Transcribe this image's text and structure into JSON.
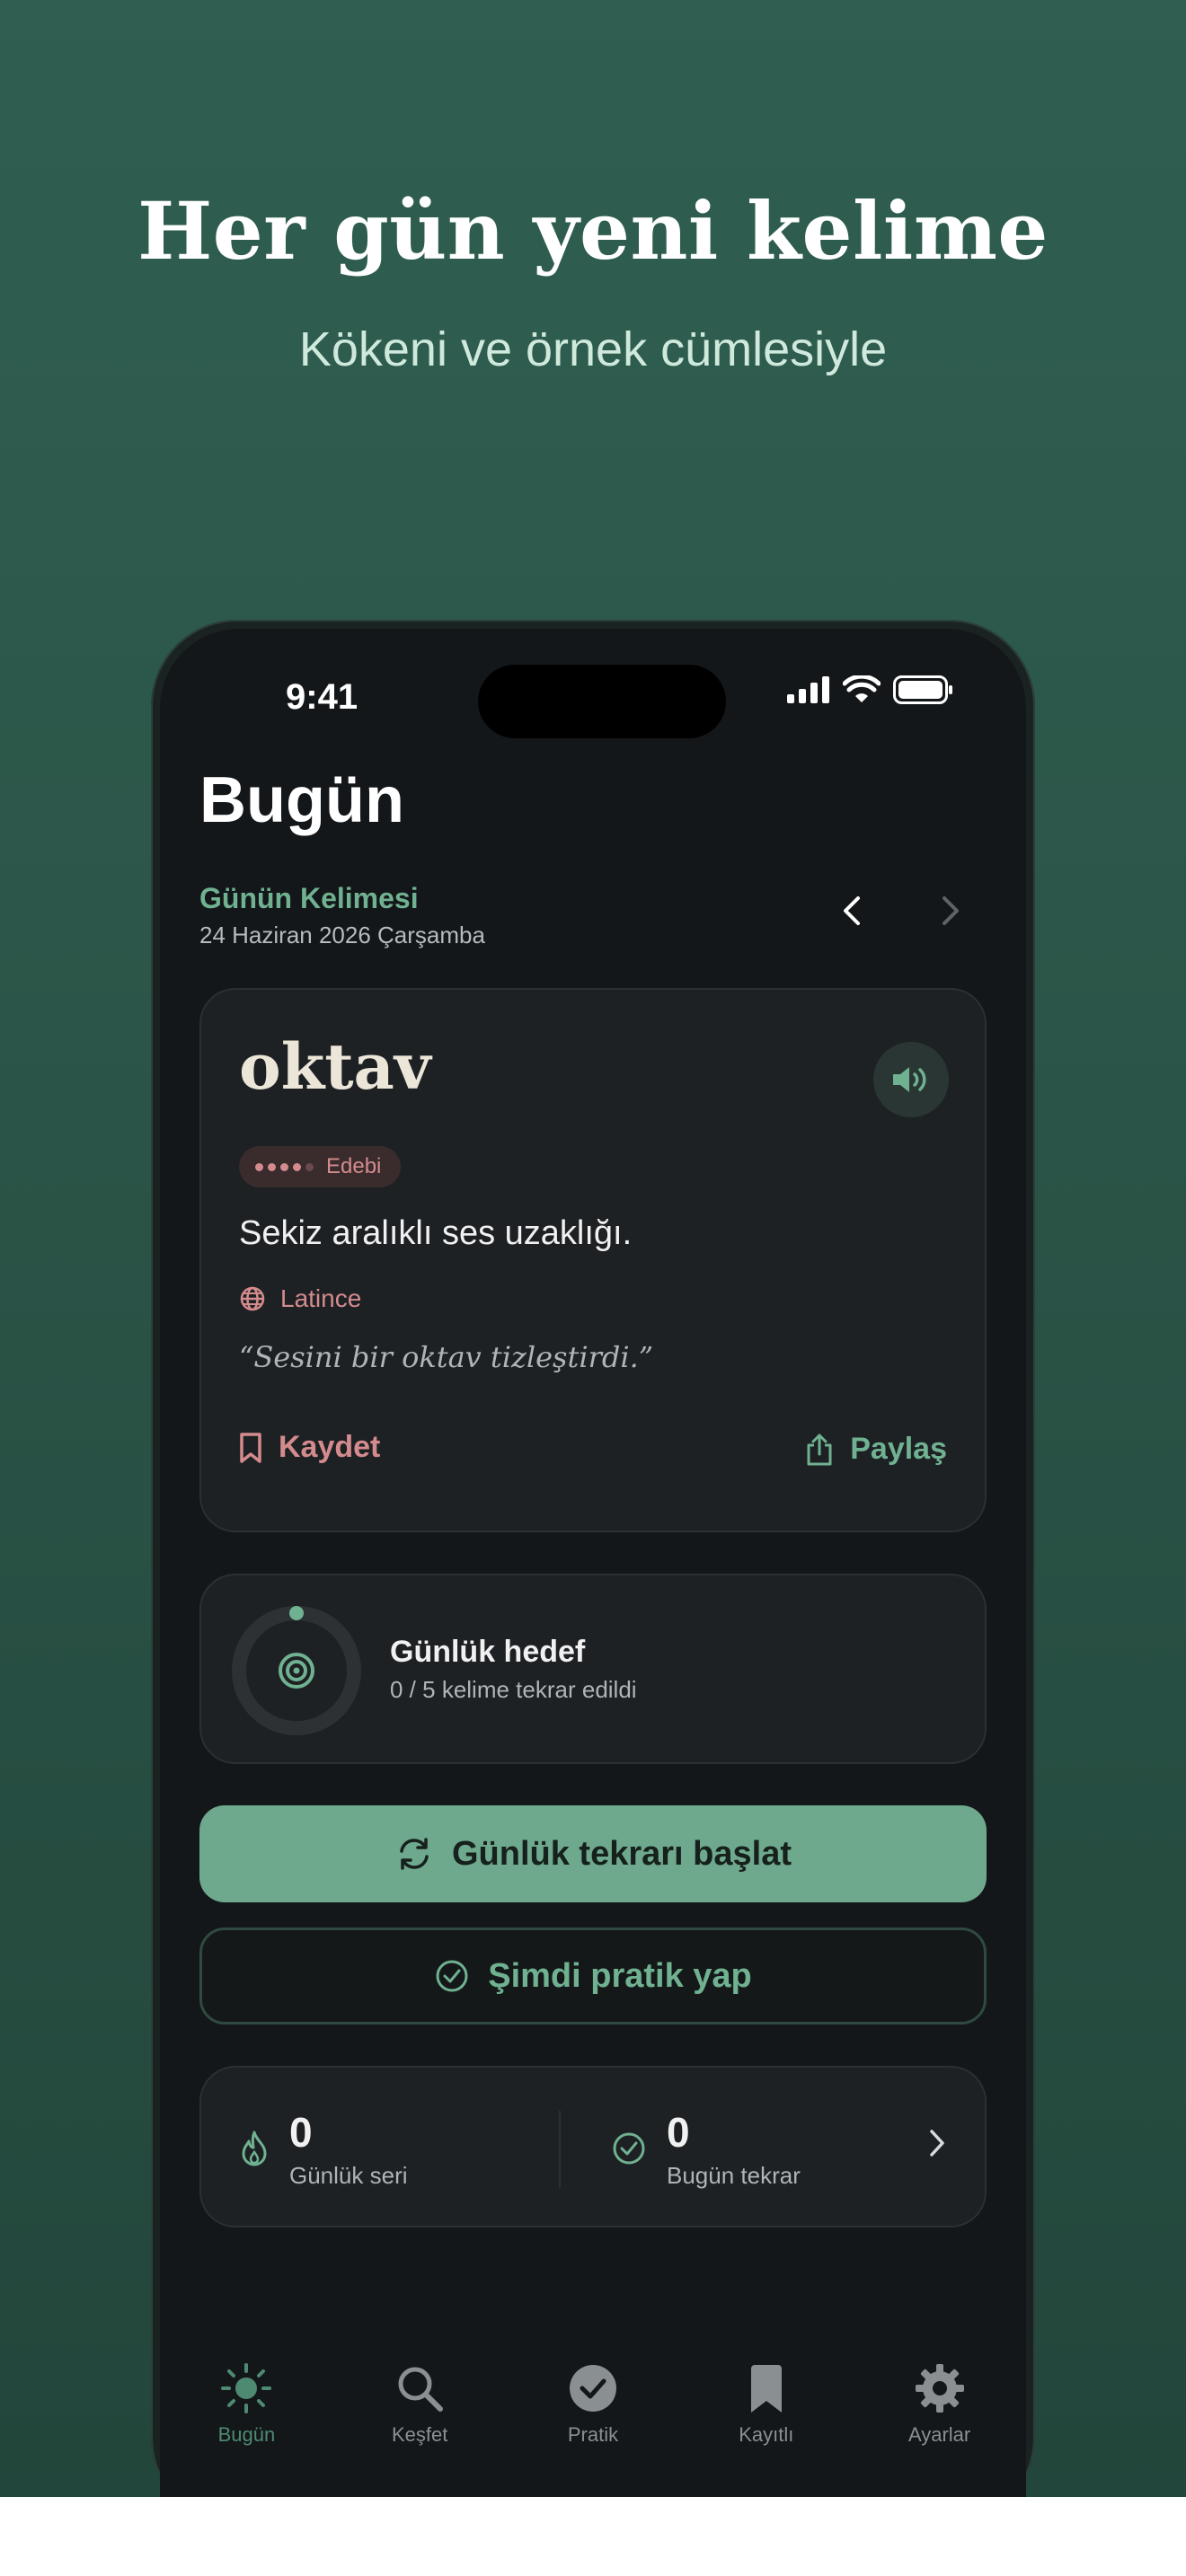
{
  "hero": {
    "title": "Her gün yeni kelime",
    "subtitle": "Kökeni ve örnek cümlesiyle"
  },
  "status_bar": {
    "time": "9:41",
    "icons": [
      "signal-icon",
      "wifi-icon",
      "battery-icon"
    ]
  },
  "header": {
    "title": "Bugün",
    "section_label": "Günün Kelimesi",
    "date": "24 Haziran 2026 Çarşamba",
    "prev_icon": "chevron-left-icon",
    "next_icon": "chevron-right-icon"
  },
  "word_card": {
    "word": "oktav",
    "level_badge": "Edebi",
    "level": 4,
    "level_max": 5,
    "definition": "Sekiz aralıklı ses uzaklığı.",
    "origin": "Latince",
    "example": "“Sesini bir oktav tizleştirdi.”",
    "save_label": "Kaydet",
    "share_label": "Paylaş"
  },
  "daily_goal": {
    "title": "Günlük hedef",
    "progress_text": "0 / 5 kelime tekrar edildi",
    "done": 0,
    "total": 5
  },
  "actions": {
    "primary_label": "Günlük tekrarı başlat",
    "secondary_label": "Şimdi pratik yap"
  },
  "stats": {
    "streak_value": "0",
    "streak_label": "Günlük seri",
    "review_value": "0",
    "review_label": "Bugün tekrar"
  },
  "tabbar": {
    "tabs": [
      {
        "label": "Bugün",
        "icon": "sun-icon",
        "active": true
      },
      {
        "label": "Keşfet",
        "icon": "search-icon",
        "active": false
      },
      {
        "label": "Pratik",
        "icon": "check-circle-icon",
        "active": false
      },
      {
        "label": "Kayıtlı",
        "icon": "bookmark-icon",
        "active": false
      },
      {
        "label": "Ayarlar",
        "icon": "gear-icon",
        "active": false
      }
    ]
  },
  "colors": {
    "accent_green": "#6fb190",
    "accent_rose": "#d48b8d",
    "background": "#141719",
    "card": "#1e2124"
  }
}
